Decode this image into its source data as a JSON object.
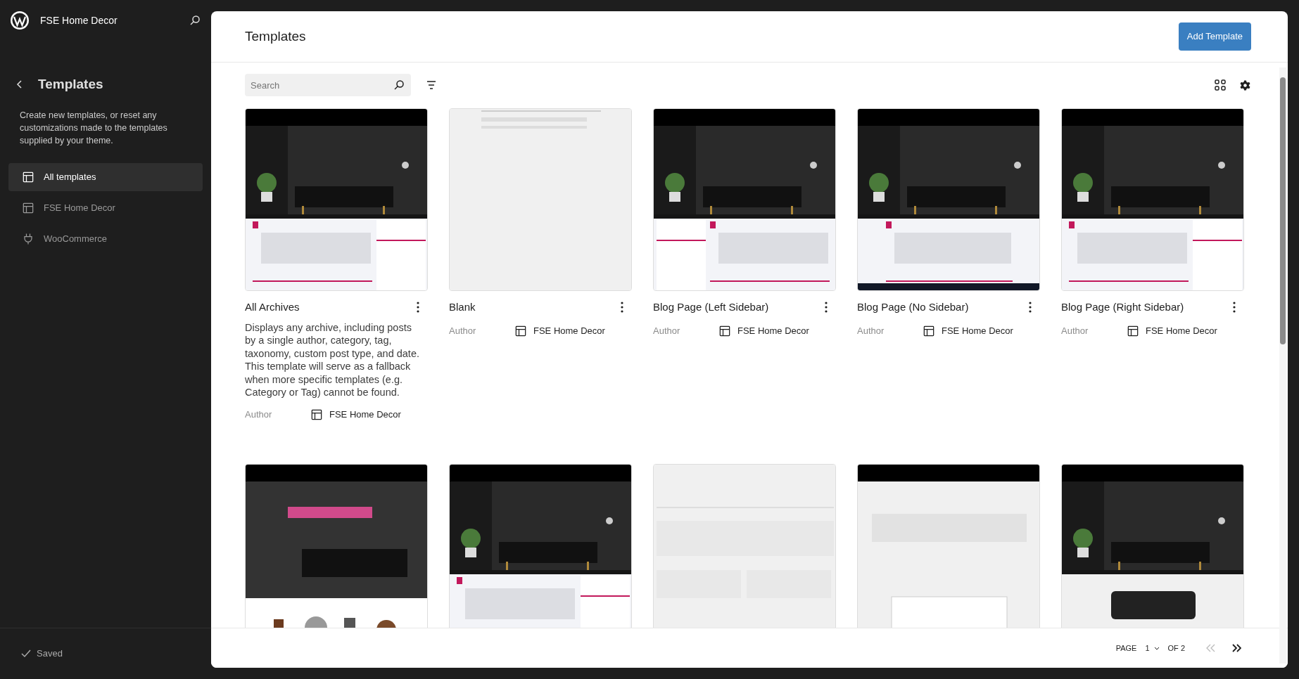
{
  "site": {
    "title": "FSE Home Decor"
  },
  "sidebar": {
    "title": "Templates",
    "description": "Create new templates, or reset any customizations made to the templates supplied by your theme.",
    "items": [
      {
        "label": "All templates",
        "kind": "template",
        "selected": true
      },
      {
        "label": "FSE Home Decor",
        "kind": "template",
        "selected": false
      },
      {
        "label": "WooCommerce",
        "kind": "plugin",
        "selected": false
      }
    ],
    "status": "Saved"
  },
  "header": {
    "title": "Templates",
    "add_button": "Add Template"
  },
  "search": {
    "placeholder": "Search"
  },
  "templates": [
    {
      "title": "All Archives",
      "description": "Displays any archive, including posts by a single author, category, tag, taxonomy, custom post type, and date. This template will serve as a fallback when more specific templates (e.g. Category or Tag) cannot be found.",
      "author_label": "Author",
      "author": "FSE Home Decor"
    },
    {
      "title": "Blank",
      "author_label": "Author",
      "author": "FSE Home Decor"
    },
    {
      "title": "Blog Page (Left Sidebar)",
      "author_label": "Author",
      "author": "FSE Home Decor"
    },
    {
      "title": "Blog Page (No Sidebar)",
      "author_label": "Author",
      "author": "FSE Home Decor"
    },
    {
      "title": "Blog Page (Right Sidebar)",
      "author_label": "Author",
      "author": "FSE Home Decor"
    }
  ],
  "pagination": {
    "label": "PAGE",
    "page": "1",
    "of": "OF 2"
  }
}
